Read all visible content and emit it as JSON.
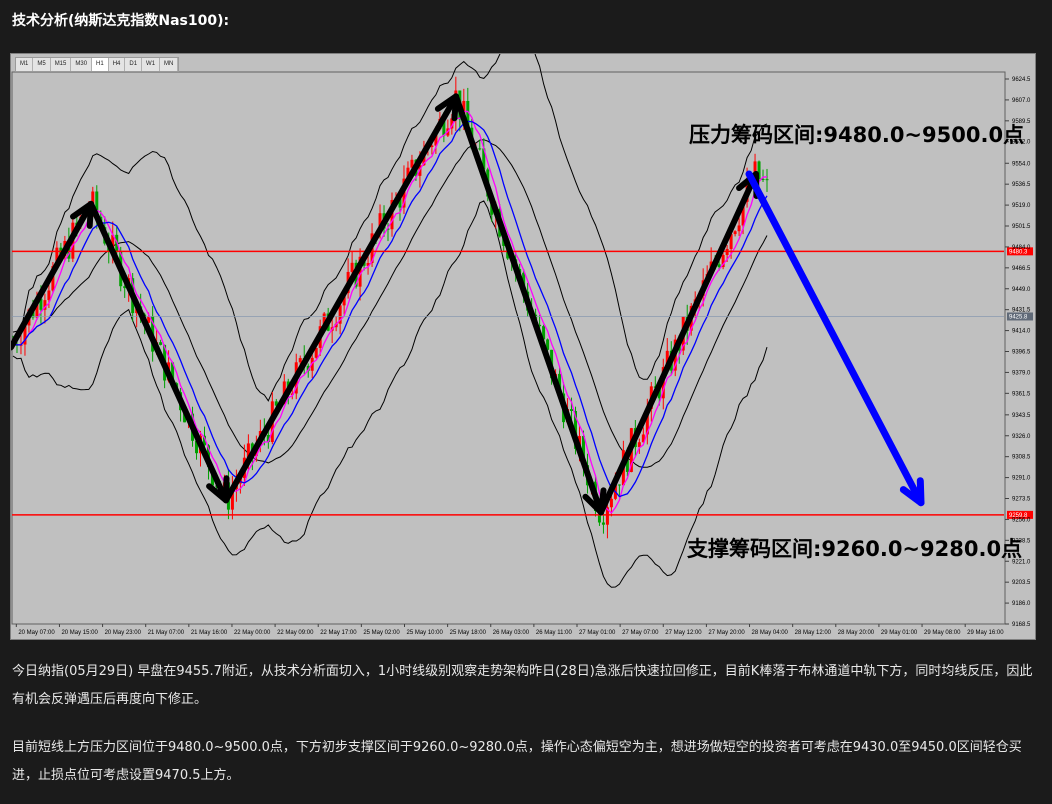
{
  "title": "技术分析(纳斯达克指数Nas100):",
  "timeframes": [
    "M1",
    "M5",
    "M15",
    "M30",
    "H1",
    "H4",
    "D1",
    "W1",
    "MN"
  ],
  "active_timeframe": "H1",
  "price_axis": {
    "ticks": [
      "9624.5",
      "9607.0",
      "9589.5",
      "9572.0",
      "9554.0",
      "9536.5",
      "9519.0",
      "9501.5",
      "9484.0",
      "9466.5",
      "9449.0",
      "9431.5",
      "9414.0",
      "9396.5",
      "9379.0",
      "9361.5",
      "9343.5",
      "9326.0",
      "9308.5",
      "9291.0",
      "9273.5",
      "9256.0",
      "9238.5",
      "9221.0",
      "9203.5",
      "9186.0",
      "9168.5"
    ],
    "resistance_tag": "9480.3",
    "current_tag": "9425.8",
    "support_tag": "9259.8"
  },
  "time_axis": {
    "ticks": [
      "20 May 07:00",
      "20 May 15:00",
      "20 May 23:00",
      "21 May 07:00",
      "21 May 16:00",
      "22 May 00:00",
      "22 May 09:00",
      "22 May 17:00",
      "25 May 02:00",
      "25 May 10:00",
      "25 May 18:00",
      "26 May 03:00",
      "26 May 11:00",
      "27 May 01:00",
      "27 May 07:00",
      "27 May 12:00",
      "27 May 20:00",
      "28 May 04:00",
      "28 May 12:00",
      "28 May 20:00",
      "29 May 01:00",
      "29 May 08:00",
      "29 May 16:00"
    ]
  },
  "chart_data": {
    "type": "candlestick",
    "symbol": "Nas100",
    "timeframe": "H1",
    "ylim": [
      9168.5,
      9624.5
    ],
    "resistance_line": 9480.3,
    "support_line": 9259.8,
    "current_price": 9425.8,
    "swing_points": [
      {
        "time": "20 May 07:00",
        "price": 9400
      },
      {
        "time": "20 May 23:00",
        "price": 9520
      },
      {
        "time": "22 May 00:00",
        "price": 9272
      },
      {
        "time": "26 May 03:00",
        "price": 9610
      },
      {
        "time": "27 May 07:00",
        "price": 9262
      },
      {
        "time": "28 May 20:00",
        "price": 9545
      }
    ],
    "projection": {
      "from": 9545,
      "to": 9270
    },
    "annotations": [
      "压力筹码区间:9480.0~9500.0点",
      "支撑筹码区间:9260.0~9280.0点"
    ]
  },
  "chart_labels": {
    "resistance": "压力筹码区间:9480.0~9500.0点",
    "support": "支撑筹码区间:9260.0~9280.0点"
  },
  "paragraphs": [
    "今日纳指(05月29日) 早盘在9455.7附近，从技术分析面切入，1小时线级别观察走势架构昨日(28日)急涨后快速拉回修正，目前K棒落于布林通道中轨下方，同时均线反压，因此有机会反弹遇压后再度向下修正。",
    "目前短线上方压力区间位于9480.0~9500.0点，下方初步支撑区间于9260.0~9280.0点，操作心态偏短空为主，想进场做短空的投资者可考虑在9430.0至9450.0区间轻仓买进，止损点位可考虑设置9470.5上方。"
  ],
  "colors": {
    "background": "#1b1b1b",
    "chart_bg": "#c0c0c0",
    "level_line": "#ff0000",
    "bull_candle": "#ff0000",
    "bear_candle": "#00a000",
    "bb_line": "#000000",
    "ma_fast": "#ff00ff",
    "ma_slow": "#0000ff",
    "trend_arrow": "#000000",
    "projection_arrow": "#0000ff"
  }
}
